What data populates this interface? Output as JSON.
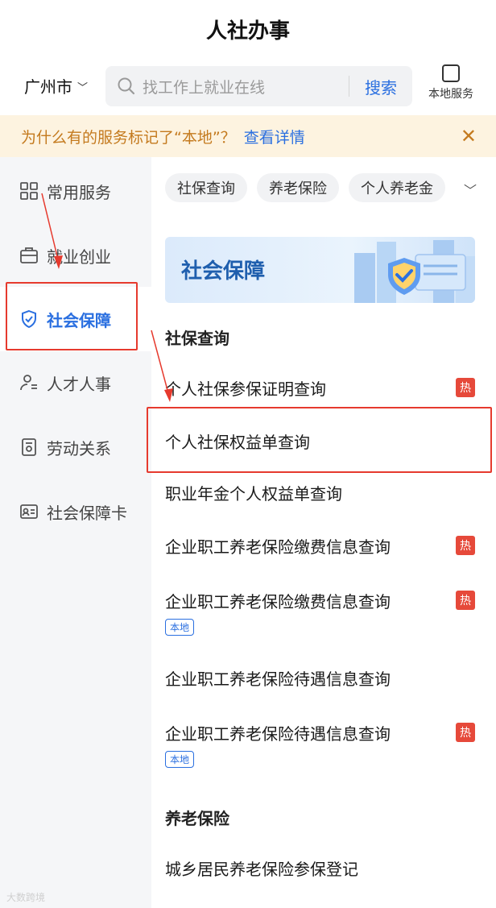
{
  "header": {
    "title": "人社办事"
  },
  "search": {
    "city": "广州市",
    "placeholder": "找工作上就业在线",
    "button": "搜索",
    "local_service": "本地服务"
  },
  "notice": {
    "question": "为什么有的服务标记了“本地”？",
    "link": "查看详情"
  },
  "sidebar": {
    "items": [
      {
        "label": "常用服务",
        "icon": "grid-icon"
      },
      {
        "label": "就业创业",
        "icon": "briefcase-icon"
      },
      {
        "label": "社会保障",
        "icon": "shield-icon",
        "active": true
      },
      {
        "label": "人才人事",
        "icon": "person-icon"
      },
      {
        "label": "劳动关系",
        "icon": "document-icon"
      },
      {
        "label": "社会保障卡",
        "icon": "id-card-icon"
      }
    ]
  },
  "chips": [
    "社保查询",
    "养老保险",
    "个人养老金"
  ],
  "banner": {
    "title": "社会保障"
  },
  "sections": [
    {
      "title": "社保查询",
      "items": [
        {
          "label": "个人社保参保证明查询",
          "hot": "热"
        },
        {
          "label": "个人社保权益单查询"
        },
        {
          "label": "职业年金个人权益单查询"
        },
        {
          "label": "企业职工养老保险缴费信息查询",
          "hot": "热"
        },
        {
          "label": "企业职工养老保险缴费信息查询",
          "hot": "热",
          "tag": "本地"
        },
        {
          "label": "企业职工养老保险待遇信息查询"
        },
        {
          "label": "企业职工养老保险待遇信息查询",
          "hot": "热",
          "tag": "本地"
        }
      ]
    },
    {
      "title": "养老保险",
      "items": [
        {
          "label": "城乡居民养老保险参保登记"
        }
      ]
    }
  ],
  "watermark": "大数跨境",
  "colors": {
    "accent": "#2a6fe0",
    "hot": "#e6493a",
    "annotation": "#e63a2e",
    "notice_bg": "#fdf3e0"
  }
}
